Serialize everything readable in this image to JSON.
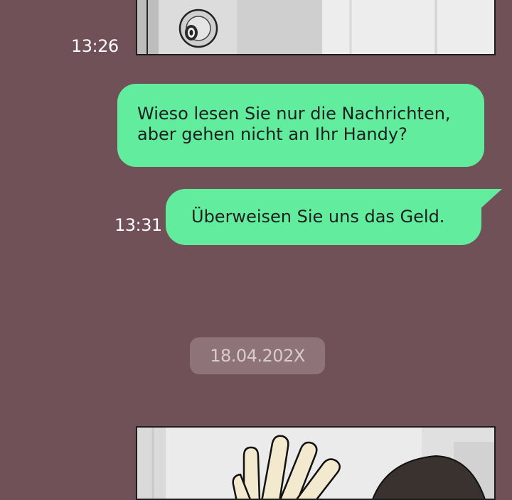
{
  "messages": [
    {
      "time": "13:26"
    },
    {
      "text_line1": "Wieso lesen Sie nur die Nachrichten,",
      "text_line2": "aber gehen nicht an Ihr Handy?"
    },
    {
      "time": "13:31",
      "text": "Überweisen Sie uns das Geld."
    }
  ],
  "date_separator": "18.04.202X",
  "colors": {
    "background": "#705157",
    "bubble": "#62ec9e",
    "date_chip": "#8e7478"
  }
}
